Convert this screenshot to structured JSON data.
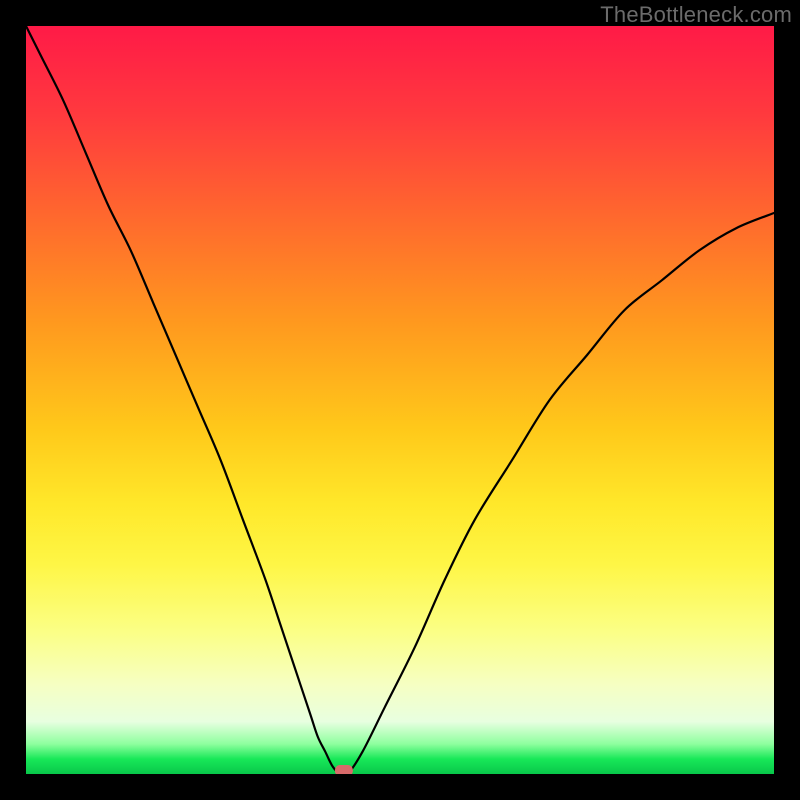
{
  "watermark": {
    "text": "TheBottleneck.com"
  },
  "colors": {
    "frame": "#000000",
    "curve": "#000000",
    "marker": "#d86a6a",
    "gradient_top": "#ff1a47",
    "gradient_bottom": "#08c74a"
  },
  "chart_data": {
    "type": "line",
    "title": "",
    "xlabel": "",
    "ylabel": "",
    "xlim": [
      0,
      100
    ],
    "ylim": [
      0,
      100
    ],
    "grid": false,
    "legend": null,
    "series": [
      {
        "name": "bottleneck-curve",
        "x": [
          0,
          2,
          5,
          8,
          11,
          14,
          17,
          20,
          23,
          26,
          29,
          32,
          34,
          36,
          38,
          39,
          40,
          41,
          42,
          43,
          45,
          48,
          52,
          56,
          60,
          65,
          70,
          75,
          80,
          85,
          90,
          95,
          100
        ],
        "y": [
          100,
          96,
          90,
          83,
          76,
          70,
          63,
          56,
          49,
          42,
          34,
          26,
          20,
          14,
          8,
          5,
          3,
          1,
          0,
          0,
          3,
          9,
          17,
          26,
          34,
          42,
          50,
          56,
          62,
          66,
          70,
          73,
          75
        ]
      }
    ],
    "marker": {
      "x": 42.5,
      "y": 0,
      "shape": "rounded-rect"
    }
  }
}
